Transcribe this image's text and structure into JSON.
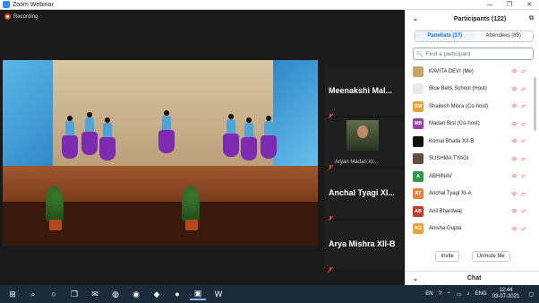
{
  "window": {
    "title": "Zoom Webinar",
    "controls": [
      "—",
      "❐",
      "✕"
    ]
  },
  "recording": {
    "label": "Recording"
  },
  "gallery": [
    {
      "name": "Meenakshi  Mal...",
      "has_video": false
    },
    {
      "name": "",
      "sub": "Aryan Madan XI...",
      "has_video": true
    },
    {
      "name": "Anchal  Tyagi  XI...",
      "has_video": false
    },
    {
      "name": "Arya Mishra XII-B",
      "has_video": false
    }
  ],
  "panel": {
    "title": "Participants (122)",
    "tabs": [
      {
        "label": "Panelists (37)",
        "active": true
      },
      {
        "label": "Attendees (85)",
        "active": false
      }
    ],
    "search_placeholder": "Find a participant",
    "participants": [
      {
        "name": "KAVITA DEVI (Me)",
        "initials": "",
        "color": "#c8a36a"
      },
      {
        "name": "Blue Bells School (Host)",
        "initials": "",
        "color": "#e8e8ee"
      },
      {
        "name": "Shailesh Misra (Co-host)",
        "initials": "SM",
        "color": "#e8a33d"
      },
      {
        "name": "Madan Bist (Co-host)",
        "initials": "MB",
        "color": "#9a3fa8"
      },
      {
        "name": "Komal Bhalla XII-B",
        "initials": "",
        "color": "#111111"
      },
      {
        "name": "SUSHMA TYAGI",
        "initials": "",
        "color": "#6a4a3a"
      },
      {
        "name": "ABHINAV",
        "initials": "A",
        "color": "#2e9a4a"
      },
      {
        "name": "Anchal Tyagi XI-A",
        "initials": "AT",
        "color": "#e8843d"
      },
      {
        "name": "Anil Bhardwaj",
        "initials": "AB",
        "color": "#c0392b"
      },
      {
        "name": "Anisha Gupta",
        "initials": "AG",
        "color": "#e8a33d"
      }
    ],
    "invite_label": "Invite",
    "unmute_label": "Unmute Me"
  },
  "chat": {
    "label": "Chat"
  },
  "taskbar": {
    "lang": "EN",
    "lang2": "ENG",
    "time": "12:44",
    "date": "03-07-2021"
  }
}
